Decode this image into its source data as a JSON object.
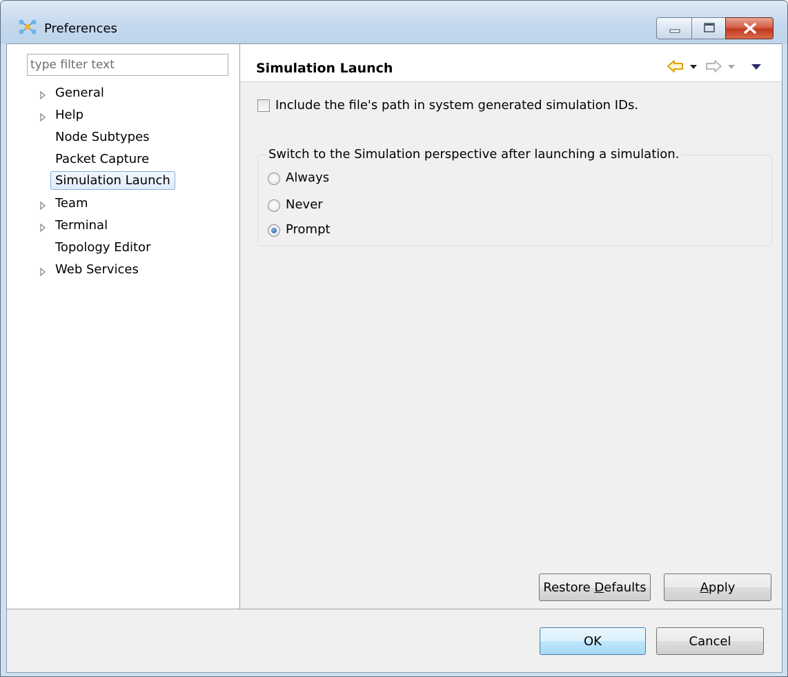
{
  "window": {
    "title": "Preferences",
    "icon": "preferences-icon",
    "controls": [
      "minimize-icon",
      "maximize-icon",
      "close-icon"
    ]
  },
  "sidebar": {
    "filter_placeholder": "type filter text",
    "items": [
      {
        "label": "General",
        "expandable": true
      },
      {
        "label": "Help",
        "expandable": true
      },
      {
        "label": "Node Subtypes",
        "expandable": false
      },
      {
        "label": "Packet Capture",
        "expandable": false
      },
      {
        "label": "Simulation Launch",
        "expandable": false,
        "selected": true
      },
      {
        "label": "Team",
        "expandable": true
      },
      {
        "label": "Terminal",
        "expandable": true
      },
      {
        "label": "Topology Editor",
        "expandable": false
      },
      {
        "label": "Web Services",
        "expandable": true
      }
    ]
  },
  "page": {
    "title": "Simulation Launch",
    "nav_icons": [
      "back-arrow-icon",
      "back-menu-icon",
      "forward-arrow-icon",
      "forward-menu-icon",
      "view-menu-icon"
    ],
    "include_path": {
      "label": "Include the file's path in system generated simulation IDs.",
      "checked": false
    },
    "perspective_group": {
      "label": "Switch to the Simulation perspective after launching a simulation.",
      "options": [
        {
          "label": "Always",
          "checked": false
        },
        {
          "label": "Never",
          "checked": false
        },
        {
          "label": "Prompt",
          "checked": true
        }
      ]
    },
    "restore_defaults": {
      "pre": "Restore ",
      "mnemonic": "D",
      "post": "efaults"
    },
    "apply": {
      "pre": "",
      "mnemonic": "A",
      "post": "pply"
    }
  },
  "footer": {
    "ok_label": "OK",
    "cancel_label": "Cancel"
  },
  "colors": {
    "titlebar": "#c5d9ee",
    "client_bg": "#f0f0f0",
    "selection_border": "#84acdd",
    "default_button": "#bee6fd"
  }
}
